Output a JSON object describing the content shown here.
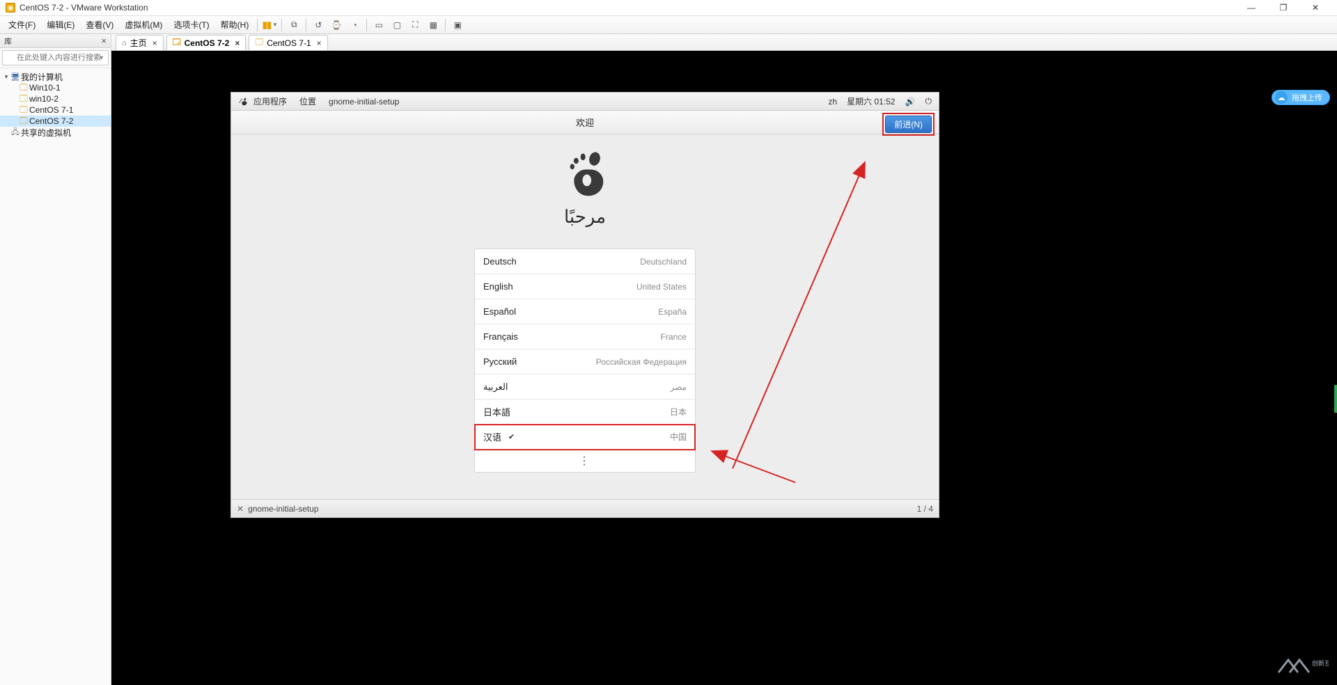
{
  "window": {
    "title": "CentOS 7-2 - VMware Workstation",
    "min_icon": "—",
    "max_icon": "❐",
    "close_icon": "✕"
  },
  "menu": {
    "items": [
      "文件(F)",
      "编辑(E)",
      "查看(V)",
      "虚拟机(M)",
      "选项卡(T)",
      "帮助(H)"
    ],
    "pause": "▮▮"
  },
  "library": {
    "header": "库",
    "search_placeholder": "在此处键入内容进行搜索",
    "nodes": {
      "root": "我的计算机",
      "vm1": "Win10-1",
      "vm2": "win10-2",
      "vm3": "CentOS 7-1",
      "vm4": "CentOS 7-2",
      "shared": "共享的虚拟机"
    }
  },
  "tabs": {
    "home": "主页",
    "t1": "CentOS 7-2",
    "t2": "CentOS 7-1"
  },
  "upload_badge": "拖拽上传",
  "gnome": {
    "apps": "应用程序",
    "places": "位置",
    "app_name": "gnome-initial-setup",
    "lang_ind": "zh",
    "weekday_time": "星期六 01:52",
    "welcome_title": "欢迎",
    "next_btn": "前进(N)",
    "greeting": "مرحبًا",
    "taskbar_app": "gnome-initial-setup",
    "workspace": "1 / 4"
  },
  "languages": [
    {
      "name": "Deutsch",
      "country": "Deutschland",
      "selected": false
    },
    {
      "name": "English",
      "country": "United States",
      "selected": false
    },
    {
      "name": "Español",
      "country": "España",
      "selected": false
    },
    {
      "name": "Français",
      "country": "France",
      "selected": false
    },
    {
      "name": "Русский",
      "country": "Российская Федерация",
      "selected": false
    },
    {
      "name": "العربية",
      "country": "مصر",
      "selected": false
    },
    {
      "name": "日本語",
      "country": "日本",
      "selected": false
    },
    {
      "name": "汉语",
      "country": "中国",
      "selected": true
    }
  ],
  "brand": "创新互联"
}
